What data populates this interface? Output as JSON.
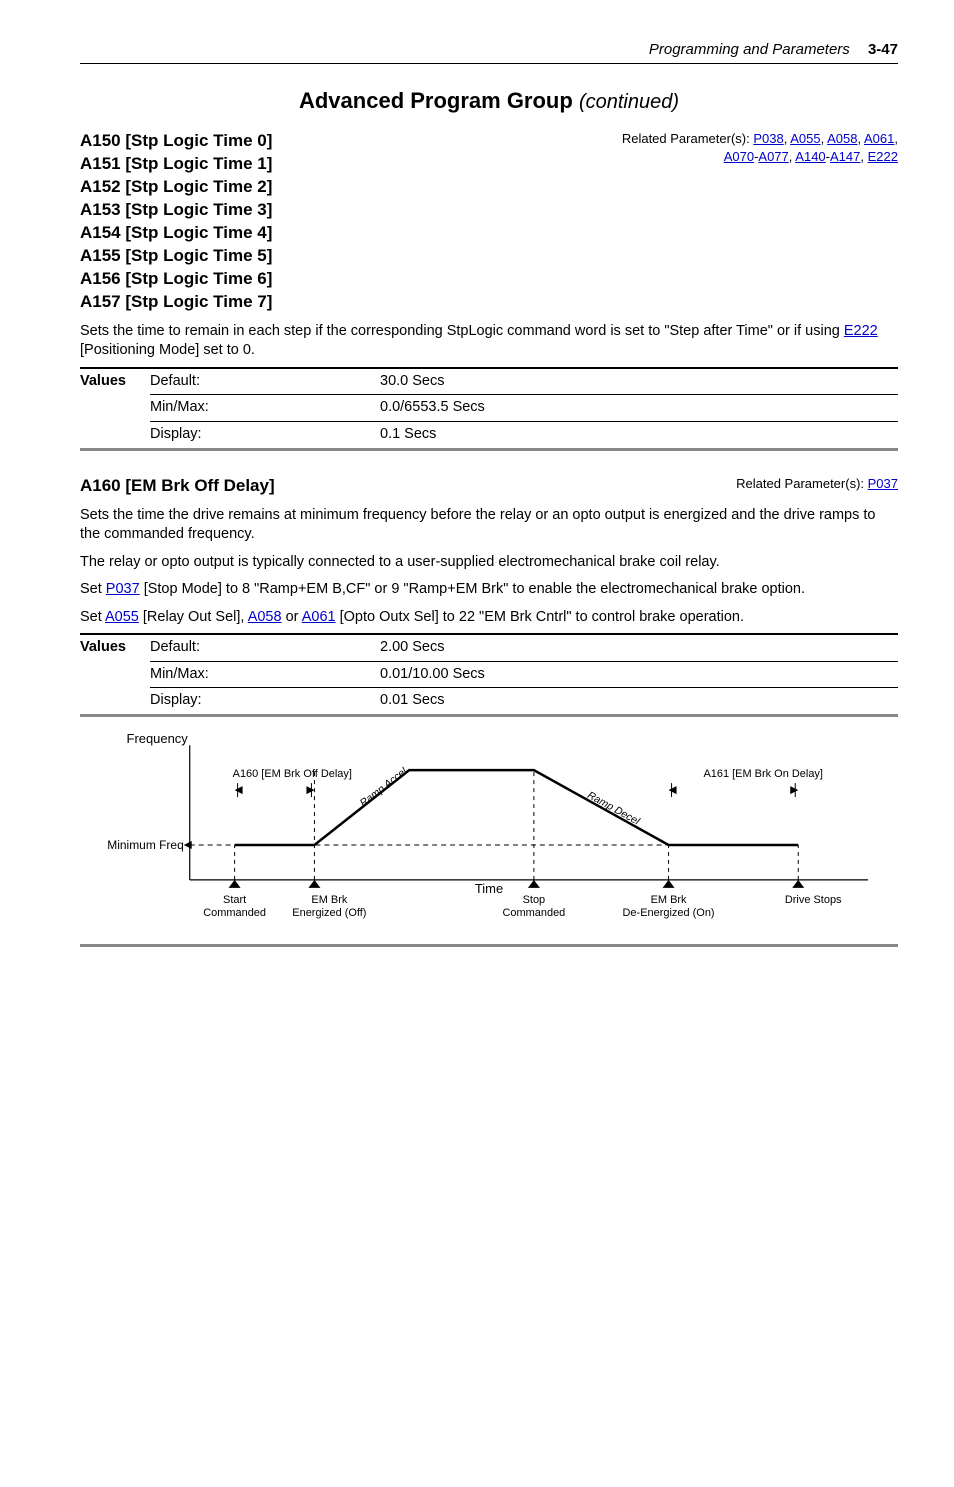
{
  "header": {
    "section": "Programming and Parameters",
    "page": "3-47"
  },
  "group_title": {
    "main": "Advanced Program Group",
    "cont": "(continued)"
  },
  "block1": {
    "params": [
      "A150 [Stp Logic Time 0]",
      "A151 [Stp Logic Time 1]",
      "A152 [Stp Logic Time 2]",
      "A153 [Stp Logic Time 3]",
      "A154 [Stp Logic Time 4]",
      "A155 [Stp Logic Time 5]",
      "A156 [Stp Logic Time 6]",
      "A157 [Stp Logic Time 7]"
    ],
    "related_prefix": "Related Parameter(s): ",
    "rel_links": {
      "p038": "P038",
      "a055": "A055",
      "a058": "A058",
      "a061": "A061",
      "a070": "A070",
      "a077": "A077",
      "a140": "A140",
      "a147": "A147",
      "e222": "E222"
    },
    "desc_a": "Sets the time to remain in each step if the corresponding StpLogic command word is set to \"Step after Time\" or if using ",
    "desc_link": "E222",
    "desc_b": " [Positioning Mode] set to 0.",
    "table": {
      "values_label": "Values",
      "r1a": "Default:",
      "r1b": "30.0 Secs",
      "r2a": "Min/Max:",
      "r2b": "0.0/6553.5 Secs",
      "r3a": "Display:",
      "r3b": "0.1 Secs"
    }
  },
  "block2": {
    "title": "A160 [EM Brk Off Delay]",
    "related_prefix": "Related Parameter(s): ",
    "rel_link": "P037",
    "p1": "Sets the time the drive remains at minimum frequency before the relay or an opto output is energized and the drive ramps to the commanded frequency.",
    "p2": "The relay or opto output is typically connected to a user-supplied electromechanical brake coil relay.",
    "p3a": "Set ",
    "p3l1": "P037",
    "p3b": " [Stop Mode] to 8 \"Ramp+EM B,CF\" or 9 \"Ramp+EM Brk\" to enable the electromechanical brake option.",
    "p4a": "Set ",
    "p4l1": "A055",
    "p4b": " [Relay Out Sel], ",
    "p4l2": "A058",
    "p4c": " or ",
    "p4l3": "A061",
    "p4d": " [Opto Outx Sel] to 22 \"EM Brk Cntrl\" to control brake operation.",
    "table": {
      "values_label": "Values",
      "r1a": "Default:",
      "r1b": "2.00 Secs",
      "r2a": "Min/Max:",
      "r2b": "0.01/10.00 Secs",
      "r3a": "Display:",
      "r3b": "0.01 Secs"
    }
  },
  "chart": {
    "ylabel": "Frequency",
    "xlabel": "Time",
    "minline": "Minimum Freq",
    "off_delay": "A160 [EM Brk Off Delay]",
    "on_delay": "A161 [EM Brk On Delay]",
    "ramp_accel": "Ramp Accel",
    "ramp_decel": "Ramp Decel",
    "ev1a": "Start",
    "ev1b": "Commanded",
    "ev2a": "EM Brk",
    "ev2b": "Energized (Off)",
    "ev3a": "Stop",
    "ev3b": "Commanded",
    "ev4a": "EM Brk",
    "ev4b": "De-Energized (On)",
    "ev5a": "Drive Stops",
    "ev5b": ""
  },
  "chart_data": {
    "type": "line",
    "title": "EM Brake Timing Profile",
    "xlabel": "Time",
    "ylabel": "Frequency",
    "annotations": [
      "Minimum Freq",
      "A160 [EM Brk Off Delay]",
      "A161 [EM Brk On Delay]",
      "Ramp Accel",
      "Ramp Decel"
    ],
    "x_events": [
      "Start Commanded",
      "EM Brk Energized (Off)",
      "Stop Commanded",
      "EM Brk De-Energized (On)",
      "Drive Stops"
    ],
    "profile_points": [
      {
        "x": 0,
        "y": 0.25,
        "note": "Start Commanded, at Minimum Freq"
      },
      {
        "x": 0.15,
        "y": 0.25,
        "note": "EM Brk Energized (Off)"
      },
      {
        "x": 0.32,
        "y": 1.0,
        "note": "Ramp Accel to commanded freq"
      },
      {
        "x": 0.5,
        "y": 1.0,
        "note": "Stop Commanded"
      },
      {
        "x": 0.72,
        "y": 0.25,
        "note": "Ramp Decel to Minimum Freq / EM Brk De-Energized (On)"
      },
      {
        "x": 0.9,
        "y": 0.25,
        "note": "Drive Stops"
      }
    ],
    "ylim": [
      0,
      1
    ]
  }
}
